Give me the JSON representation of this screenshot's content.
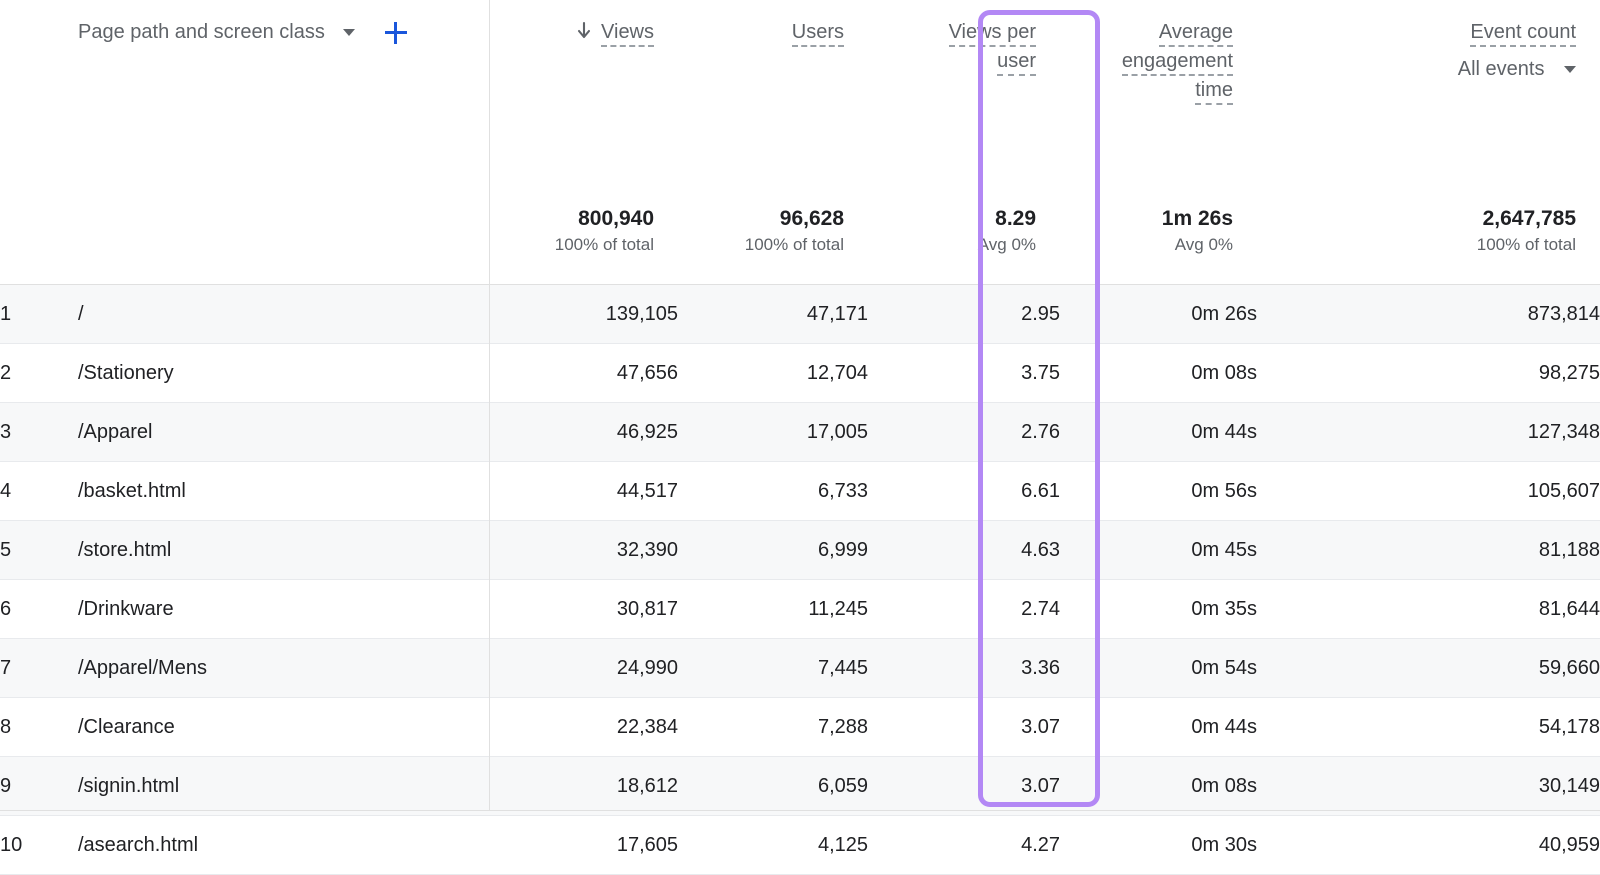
{
  "dimension_selector": {
    "label": "Page path and screen class",
    "caret_icon": "chevron-down-icon",
    "add_icon": "plus-icon"
  },
  "columns": [
    {
      "key": "views",
      "label_lines": [
        "Views"
      ],
      "sort_icon": "arrow-down-icon",
      "sorted": true
    },
    {
      "key": "users",
      "label_lines": [
        "Users"
      ],
      "sorted": false
    },
    {
      "key": "views_per_user",
      "label_lines": [
        "Views per",
        "user"
      ],
      "sorted": false,
      "highlighted": true
    },
    {
      "key": "avg_engagement_time",
      "label_lines": [
        "Average",
        "engagement",
        "time"
      ],
      "sorted": false
    },
    {
      "key": "event_count",
      "label_lines": [
        "Event count"
      ],
      "sorted": false,
      "dropdown": "All events"
    }
  ],
  "totals": {
    "views": {
      "value": "800,940",
      "sub": "100% of total"
    },
    "users": {
      "value": "96,628",
      "sub": "100% of total"
    },
    "views_per_user": {
      "value": "8.29",
      "sub": "Avg 0%"
    },
    "avg_engagement_time": {
      "value": "1m 26s",
      "sub": "Avg 0%"
    },
    "event_count": {
      "value": "2,647,785",
      "sub": "100% of total"
    }
  },
  "rows": [
    {
      "rank": "1",
      "page": "/",
      "views": "139,105",
      "users": "47,171",
      "views_per_user": "2.95",
      "avg_engagement_time": "0m 26s",
      "event_count": "873,814"
    },
    {
      "rank": "2",
      "page": "/Stationery",
      "views": "47,656",
      "users": "12,704",
      "views_per_user": "3.75",
      "avg_engagement_time": "0m 08s",
      "event_count": "98,275"
    },
    {
      "rank": "3",
      "page": "/Apparel",
      "views": "46,925",
      "users": "17,005",
      "views_per_user": "2.76",
      "avg_engagement_time": "0m 44s",
      "event_count": "127,348"
    },
    {
      "rank": "4",
      "page": "/basket.html",
      "views": "44,517",
      "users": "6,733",
      "views_per_user": "6.61",
      "avg_engagement_time": "0m 56s",
      "event_count": "105,607"
    },
    {
      "rank": "5",
      "page": "/store.html",
      "views": "32,390",
      "users": "6,999",
      "views_per_user": "4.63",
      "avg_engagement_time": "0m 45s",
      "event_count": "81,188"
    },
    {
      "rank": "6",
      "page": "/Drinkware",
      "views": "30,817",
      "users": "11,245",
      "views_per_user": "2.74",
      "avg_engagement_time": "0m 35s",
      "event_count": "81,644"
    },
    {
      "rank": "7",
      "page": "/Apparel/Mens",
      "views": "24,990",
      "users": "7,445",
      "views_per_user": "3.36",
      "avg_engagement_time": "0m 54s",
      "event_count": "59,660"
    },
    {
      "rank": "8",
      "page": "/Clearance",
      "views": "22,384",
      "users": "7,288",
      "views_per_user": "3.07",
      "avg_engagement_time": "0m 44s",
      "event_count": "54,178"
    },
    {
      "rank": "9",
      "page": "/signin.html",
      "views": "18,612",
      "users": "6,059",
      "views_per_user": "3.07",
      "avg_engagement_time": "0m 08s",
      "event_count": "30,149"
    },
    {
      "rank": "10",
      "page": "/asearch.html",
      "views": "17,605",
      "users": "4,125",
      "views_per_user": "4.27",
      "avg_engagement_time": "0m 30s",
      "event_count": "40,959"
    }
  ],
  "highlight": {
    "column": "views_per_user",
    "color": "#b388f5"
  }
}
